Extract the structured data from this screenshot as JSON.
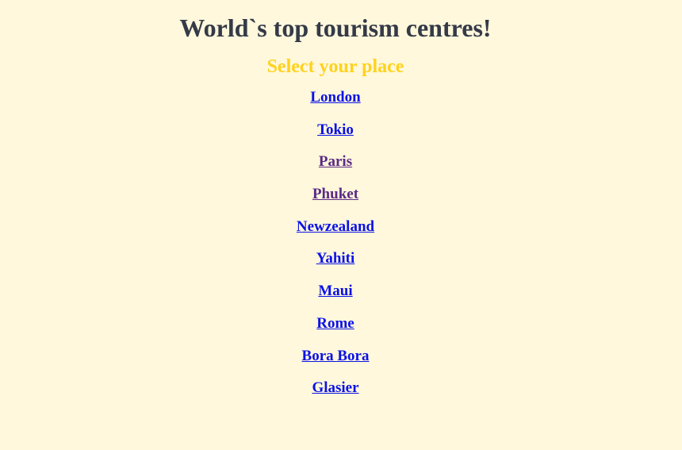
{
  "header": {
    "title": "World`s top tourism centres!",
    "subtitle": "Select your place"
  },
  "places": [
    {
      "label": "London",
      "visited": false
    },
    {
      "label": "Tokio",
      "visited": false
    },
    {
      "label": "Paris",
      "visited": true
    },
    {
      "label": "Phuket",
      "visited": true
    },
    {
      "label": "Newzealand",
      "visited": false
    },
    {
      "label": "Yahiti",
      "visited": false
    },
    {
      "label": "Maui",
      "visited": false
    },
    {
      "label": "Rome",
      "visited": false
    },
    {
      "label": "Bora Bora",
      "visited": false
    },
    {
      "label": "Glasier",
      "visited": false
    }
  ],
  "colors": {
    "background": "#fff8dc",
    "title": "#343a47",
    "subtitle": "#ffd21e",
    "link": "#0b12e6",
    "visited_link": "#5b2a86"
  }
}
